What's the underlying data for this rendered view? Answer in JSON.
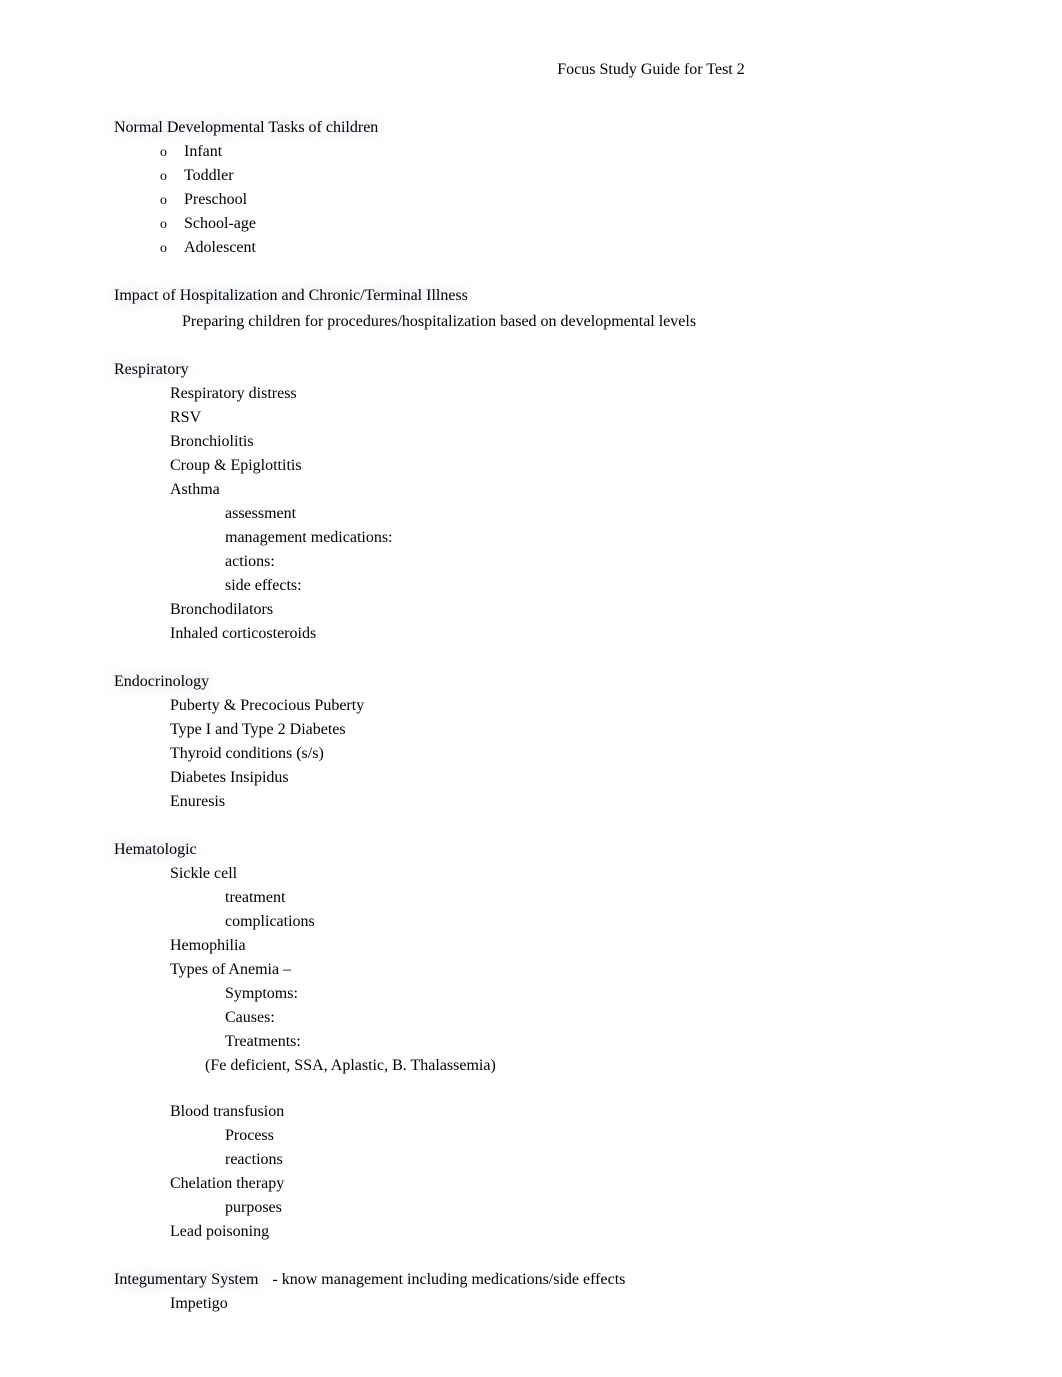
{
  "title": "Focus Study Guide for Test 2",
  "sections": {
    "developmental": {
      "heading": "Normal Developmental Tasks of children",
      "items": [
        "Infant",
        "Toddler",
        "Preschool",
        "School-age",
        "Adolescent"
      ]
    },
    "impact": {
      "heading": "Impact of Hospitalization and Chronic/Terminal Illness",
      "sub": "Preparing children for procedures/hospitalization based on developmental levels"
    },
    "respiratory": {
      "heading": "Respiratory",
      "items": {
        "distress": "Respiratory distress",
        "rsv": "RSV",
        "bronchiolitis": "Bronchiolitis",
        "croup": "Croup & Epiglottitis",
        "asthma": "Asthma",
        "asthma_sub": {
          "assessment": "assessment",
          "management": "management medications:",
          "actions": "actions:",
          "side_effects": "side effects:"
        },
        "bronchodilators": "Bronchodilators",
        "inhaled": "Inhaled corticosteroids"
      }
    },
    "endocrinology": {
      "heading": "Endocrinology",
      "items": {
        "puberty": "Puberty & Precocious Puberty",
        "diabetes12": "Type I and Type 2 Diabetes",
        "thyroid": "Thyroid conditions (s/s)",
        "di": "Diabetes Insipidus",
        "enuresis": "Enuresis"
      }
    },
    "hematologic": {
      "heading": "Hematologic",
      "items": {
        "sickle": "Sickle cell",
        "sickle_sub": {
          "treatment": "treatment",
          "complications": "complications"
        },
        "hemophilia": "Hemophilia",
        "anemia": "Types of Anemia –",
        "anemia_sub": {
          "symptoms": "Symptoms:",
          "causes": "Causes:",
          "treatments": "Treatments:"
        },
        "anemia_note": "(Fe deficient, SSA, Aplastic, B. Thalassemia)",
        "blood": "Blood transfusion",
        "blood_sub": {
          "process": "Process",
          "reactions": "reactions"
        },
        "chelation": "Chelation therapy",
        "chelation_sub": {
          "purposes": "purposes"
        },
        "lead": "Lead poisoning"
      }
    },
    "integumentary": {
      "heading": "Integumentary System",
      "note": "- know management including medications/side effects",
      "items": {
        "impetigo": "Impetigo"
      }
    }
  }
}
